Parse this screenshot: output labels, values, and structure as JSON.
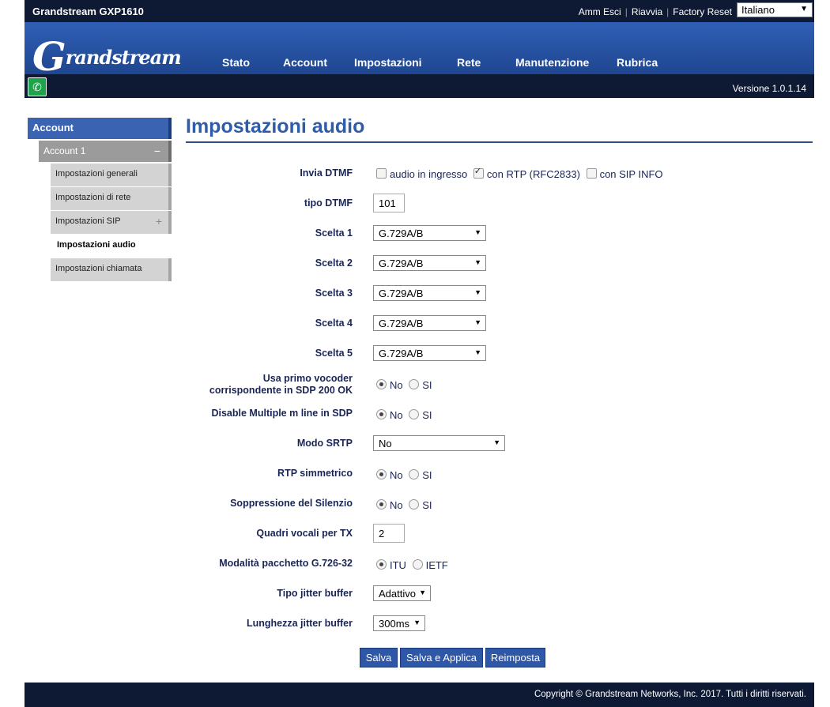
{
  "header": {
    "model": "Grandstream GXP1610",
    "links": [
      "Amm Esci",
      "Riavvia",
      "Factory Reset"
    ],
    "language": "Italiano",
    "logo_text_big": "G",
    "logo_text": "randstream",
    "nav": [
      "Stato",
      "Account",
      "Impostazioni",
      "Rete",
      "Manutenzione",
      "Rubrica"
    ],
    "version": "Versione 1.0.1.14"
  },
  "sidebar": {
    "section": "Account",
    "group": "Account 1",
    "group_toggle": "−",
    "items": [
      "Impostazioni generali",
      "Impostazioni di rete",
      "Impostazioni SIP",
      "Impostazioni audio",
      "Impostazioni chiamata"
    ],
    "sip_toggle": "+"
  },
  "main": {
    "title": "Impostazioni audio",
    "invia_dtmf": {
      "label": "Invia DTMF",
      "opt1": "audio in ingresso",
      "opt2": "con RTP (RFC2833)",
      "opt3": "con SIP INFO"
    },
    "tipo_dtmf": {
      "label": "tipo DTMF",
      "value": "101"
    },
    "scelta1": {
      "label": "Scelta 1",
      "value": "G.729A/B"
    },
    "scelta2": {
      "label": "Scelta 2",
      "value": "G.729A/B"
    },
    "scelta3": {
      "label": "Scelta 3",
      "value": "G.729A/B"
    },
    "scelta4": {
      "label": "Scelta 4",
      "value": "G.729A/B"
    },
    "scelta5": {
      "label": "Scelta 5",
      "value": "G.729A/B"
    },
    "vocoder": {
      "label1": "Usa primo vocoder",
      "label2": "corrispondente in SDP 200 OK",
      "no": "No",
      "si": "SI"
    },
    "mline": {
      "label": "Disable Multiple m line in SDP",
      "no": "No",
      "si": "SI"
    },
    "srtp": {
      "label": "Modo SRTP",
      "value": "No"
    },
    "rtp": {
      "label": "RTP simmetrico",
      "no": "No",
      "si": "SI"
    },
    "silenzio": {
      "label": "Soppressione del Silenzio",
      "no": "No",
      "si": "SI"
    },
    "quadri": {
      "label": "Quadri vocali per TX",
      "value": "2"
    },
    "g726": {
      "label": "Modalità pacchetto G.726-32",
      "opt1": "ITU",
      "opt2": "IETF"
    },
    "jitter_tipo": {
      "label": "Tipo jitter buffer",
      "value": "Adattivo"
    },
    "jitter_len": {
      "label": "Lunghezza jitter buffer",
      "value": "300ms"
    },
    "buttons": {
      "save": "Salva",
      "save_apply": "Salva e Applica",
      "reset": "Reimposta"
    }
  },
  "footer": {
    "copyright": "Copyright © Grandstream Networks, Inc. 2017. Tutti i diritti riservati."
  }
}
